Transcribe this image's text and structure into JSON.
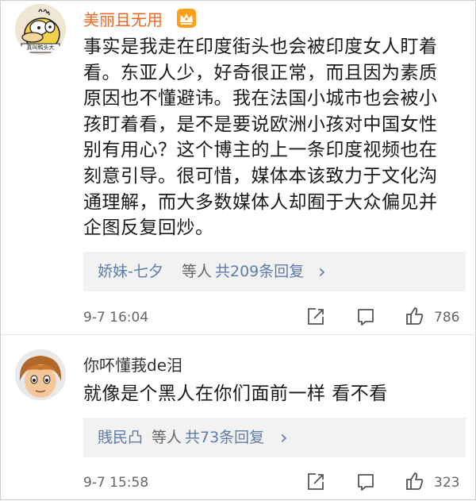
{
  "comments": [
    {
      "username": "美丽且无用",
      "avatar_icon": "psyduck-avatar",
      "avatar_tag": "真叫鸭头大",
      "badge_icon": "vip-crown-icon",
      "lines": [
        "事实是我走在印度街头也会被印度女人盯着",
        "看。东亚人少，好奇很正常，而且因为素质",
        "原因也不懂避讳。我在法国小城市也会被小",
        "孩盯着看，是不是要说欧洲小孩对中国女性",
        "别有用心？这个博主的上一条印度视频也在",
        "刻意引导。很可惜，媒体本该致力于文化沟",
        "通理解，而大多数媒体人却囿于大众偏见并",
        "企图反复回炒。"
      ],
      "reply_names": "娇妹-七夕",
      "reply_deng": "等人",
      "reply_count": "共209条回复",
      "reply_chevron": "›",
      "date": "9-7 16:04",
      "likes": "786"
    },
    {
      "username": "你吥懂莪de泪",
      "avatar_icon": "cartoon-boy-avatar",
      "lines": [
        "就像是个黑人在你们面前一样 看不看"
      ],
      "reply_names": "賎民凸",
      "reply_deng": "等人",
      "reply_count": "共73条回复",
      "reply_chevron": "›",
      "date": "9-7 15:58",
      "likes": "323"
    }
  ],
  "colors": {
    "vip_name": "#f06a24",
    "link": "#5c7caa",
    "meta": "#666666",
    "reply_bg": "#f2f2f2"
  },
  "icons": {
    "share": "share-icon",
    "comment": "comment-icon",
    "like": "thumbs-up-icon"
  }
}
